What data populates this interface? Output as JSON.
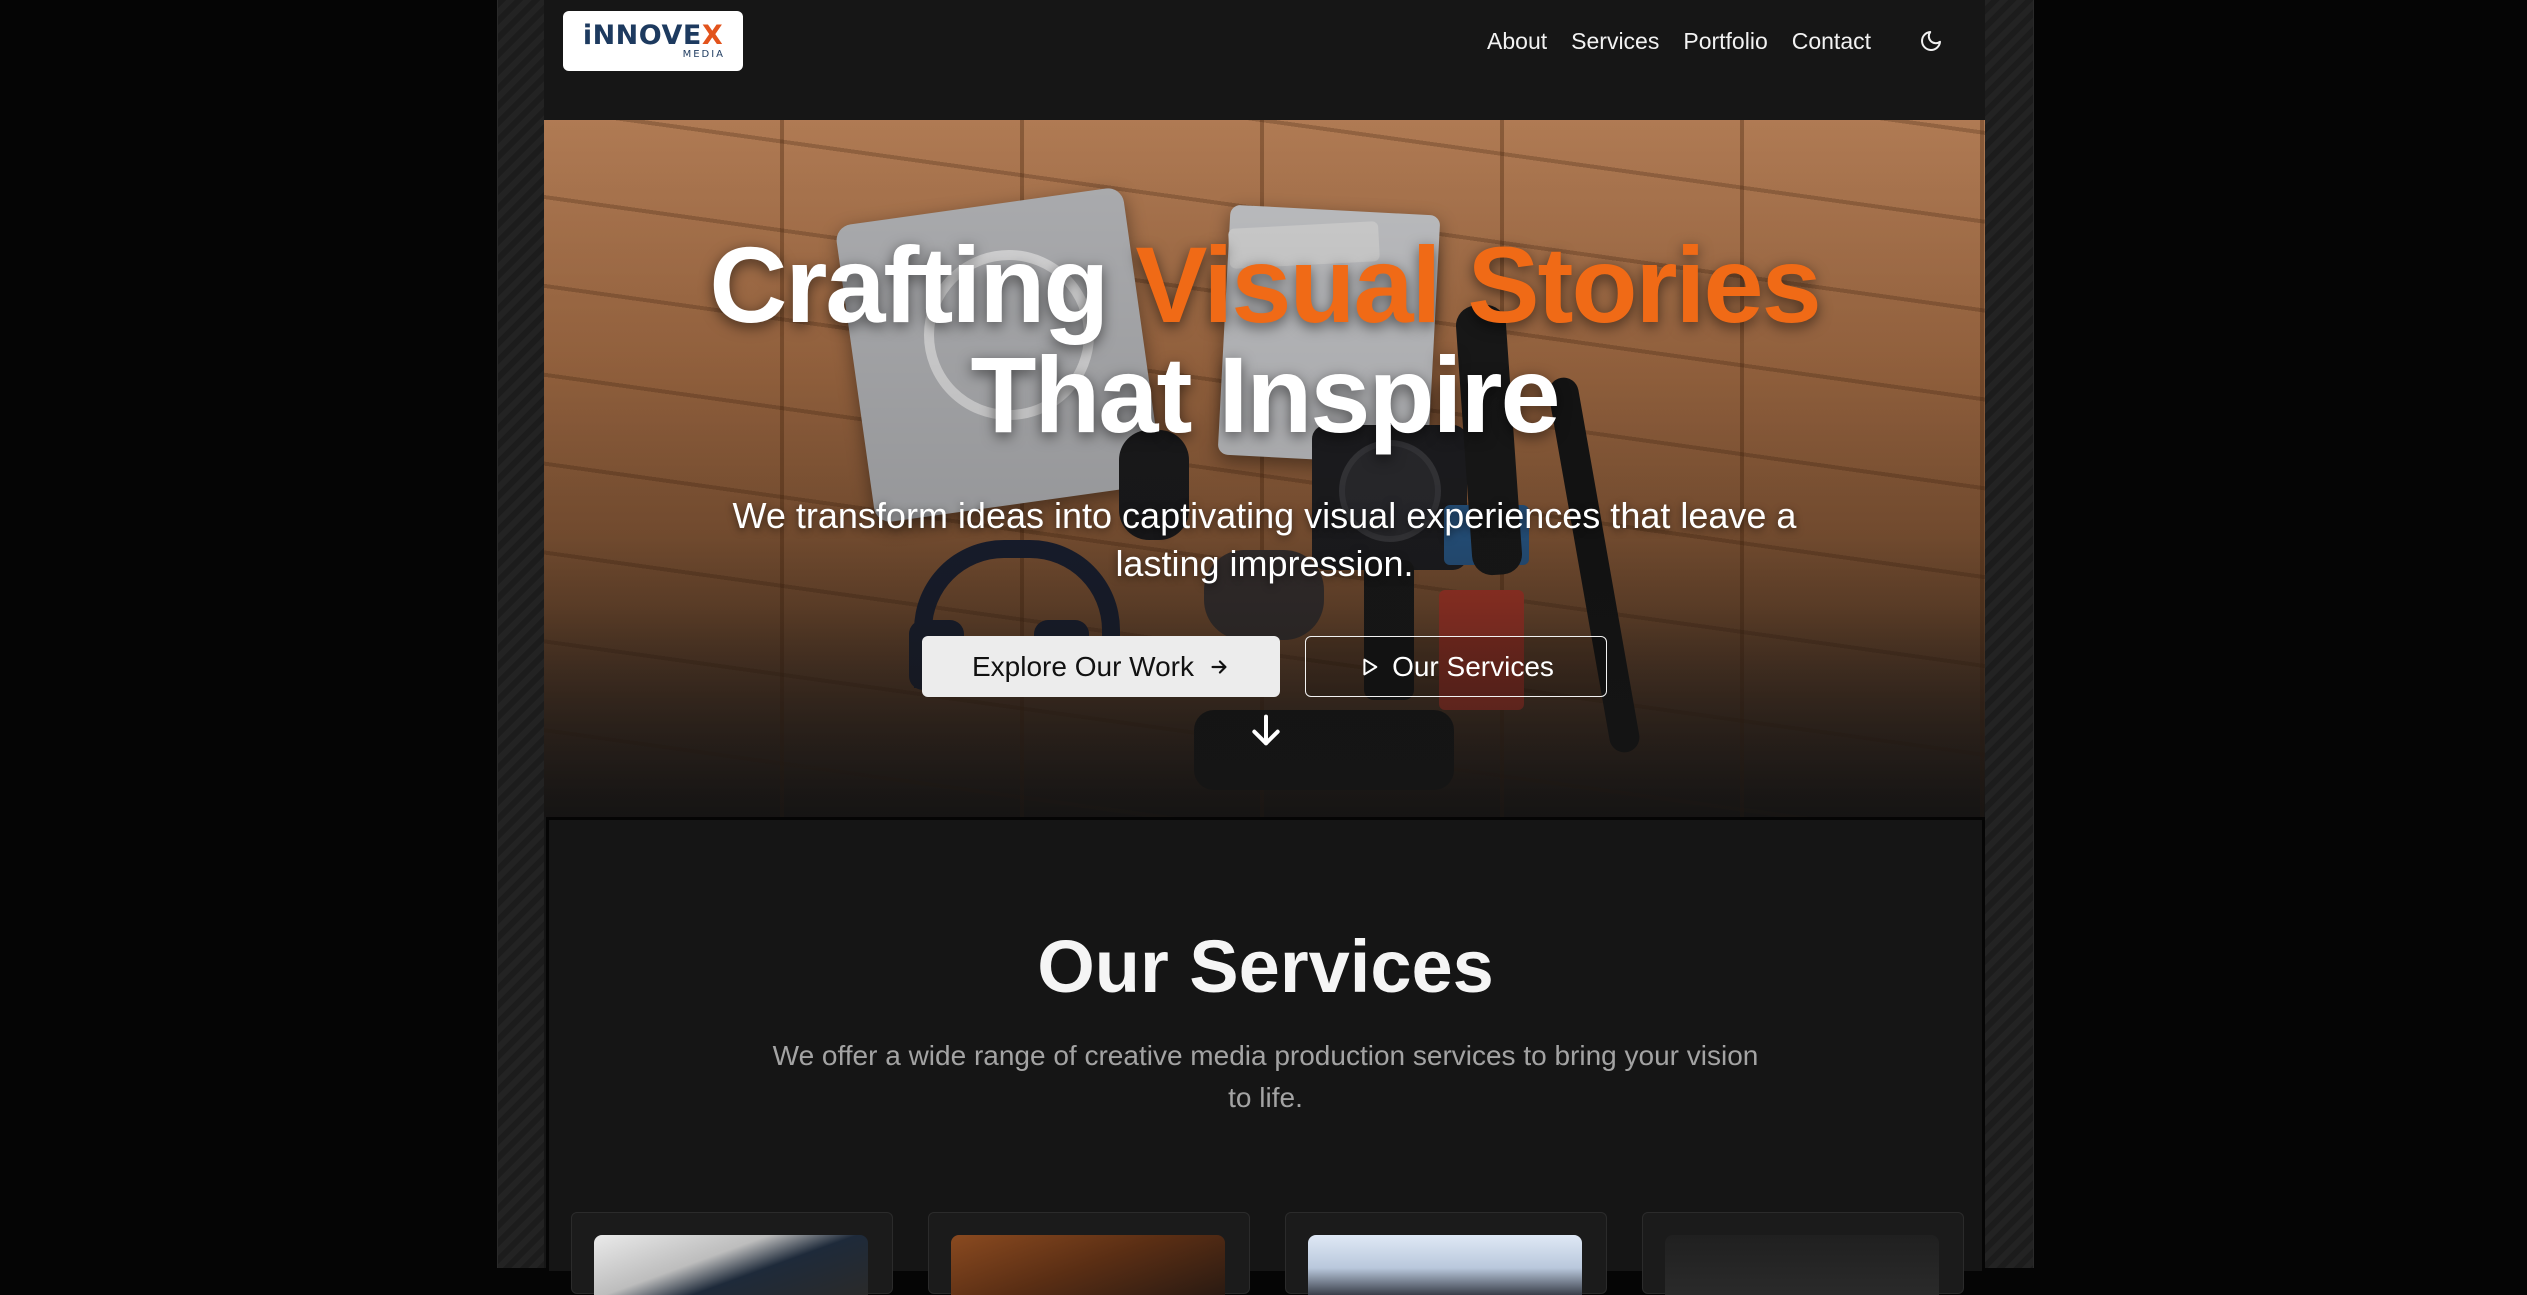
{
  "logo": {
    "brand_main": "iNNOVE",
    "brand_x": "X",
    "brand_sub": "MEDIA"
  },
  "nav": {
    "items": [
      "About",
      "Services",
      "Portfolio",
      "Contact"
    ],
    "theme_toggle_icon": "moon-icon"
  },
  "hero": {
    "title_part1": "Crafting",
    "title_accent": "Visual Stories",
    "title_line2": "That Inspire",
    "subtitle": "We transform ideas into captivating visual experiences that leave a lasting impression.",
    "primary_button": "Explore Our Work",
    "secondary_button": "Our Services",
    "primary_icon": "arrow-right-icon",
    "secondary_icon": "play-icon",
    "scroll_icon": "arrow-down-icon"
  },
  "services": {
    "title": "Our Services",
    "subtitle": "We offer a wide range of creative media production services to bring your vision to life."
  },
  "colors": {
    "accent": "#f06a16",
    "background": "#161616",
    "brand_navy": "#1d3a5f"
  }
}
